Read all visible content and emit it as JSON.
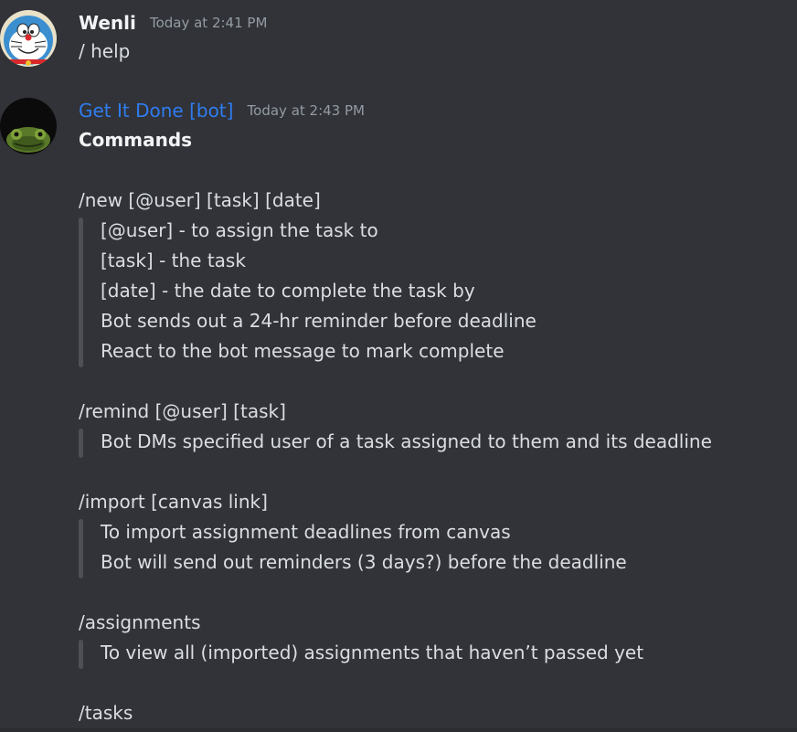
{
  "messages": [
    {
      "author": "Wenli",
      "timestamp": "Today at 2:41 PM",
      "text": "/ help",
      "avatar_icon": "doraemon-avatar"
    },
    {
      "author": "Get It Done [bot]",
      "timestamp": "Today at 2:43 PM",
      "avatar_icon": "frog-avatar",
      "heading": "Commands",
      "commands": [
        {
          "name": "/new [@user] [task] [date]",
          "details": [
            "[@user] - to assign the task to",
            "[task] - the task",
            "[date] - the date to complete the task by",
            "Bot sends out a 24-hr reminder before deadline",
            "React to the bot message to mark complete"
          ]
        },
        {
          "name": "/remind [@user] [task]",
          "details": [
            "Bot DMs specified user of a task assigned to them and its deadline"
          ]
        },
        {
          "name": "/import [canvas link]",
          "details": [
            "To import assignment deadlines from canvas",
            "Bot will send out reminders (3 days?) before the deadline"
          ]
        },
        {
          "name": "/assignments",
          "details": [
            "To view all (imported) assignments that haven’t passed yet"
          ]
        },
        {
          "name": "/tasks",
          "details": []
        }
      ]
    }
  ],
  "colors": {
    "background": "#313338",
    "bot_name": "#2f7cf0",
    "timestamp": "#949ba4",
    "quote_bar": "#4e5058",
    "text": "#dbdee1"
  }
}
